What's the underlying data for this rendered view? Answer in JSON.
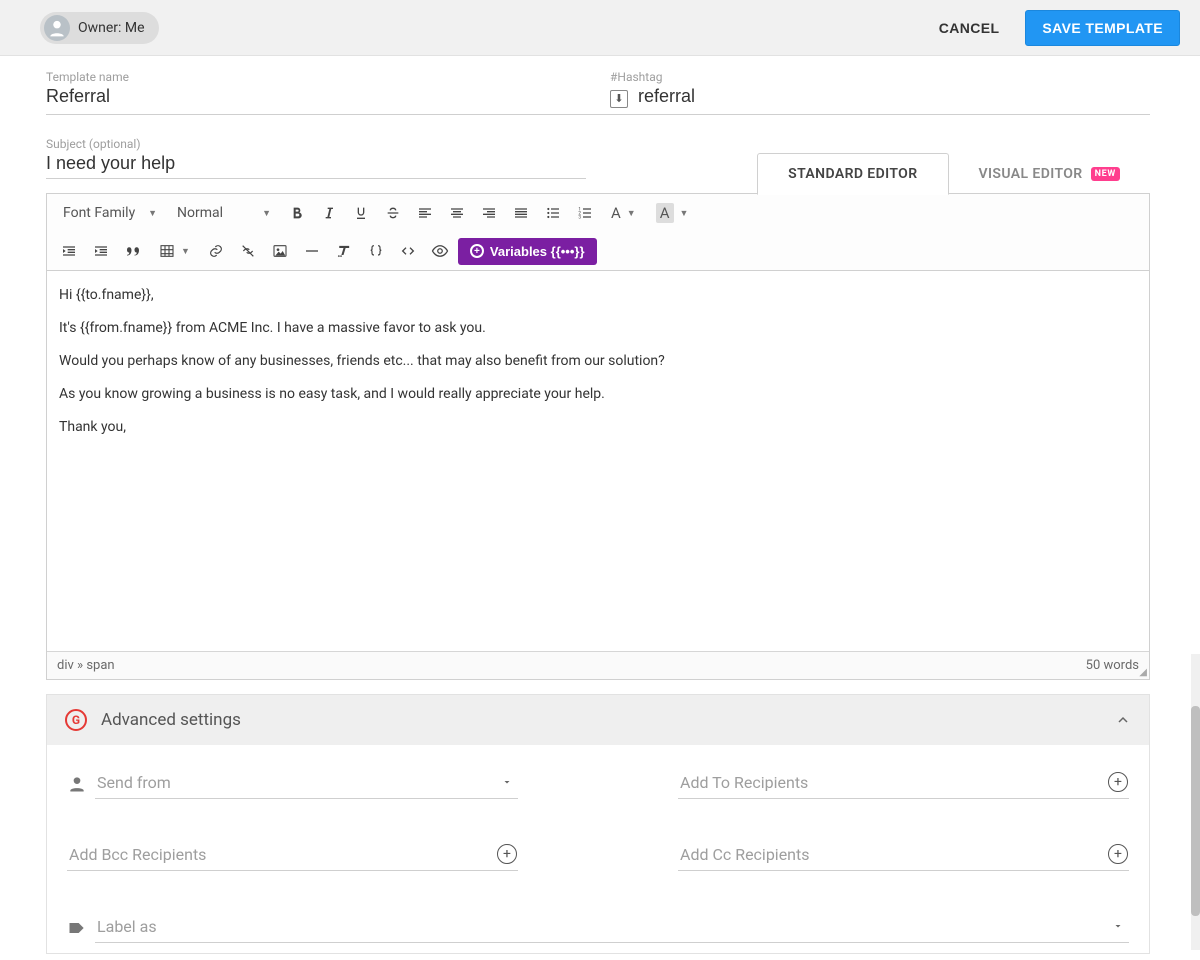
{
  "header": {
    "owner_label": "Owner: Me",
    "cancel": "CANCEL",
    "save": "SAVE TEMPLATE"
  },
  "fields": {
    "template_name_label": "Template name",
    "template_name_value": "Referral",
    "hashtag_label": "#Hashtag",
    "hashtag_value": "referral",
    "subject_label": "Subject (optional)",
    "subject_value": "I need your help"
  },
  "tabs": {
    "standard": "STANDARD EDITOR",
    "visual": "VISUAL EDITOR",
    "new_badge": "NEW"
  },
  "toolbar": {
    "font_family": "Font Family",
    "format": "Normal",
    "variables": "Variables {{•••}}"
  },
  "editor": {
    "p1": "Hi {{to.fname}},",
    "p2": "It's {{from.fname}} from ACME Inc. I have a massive favor to ask you.",
    "p3": "Would you perhaps know of any businesses, friends etc... that may also benefit from our solution?",
    "p4": "As you know growing a business is no easy task, and I would really appreciate your help.",
    "p5": "Thank you,"
  },
  "status": {
    "path": "div » span",
    "words": "50 words"
  },
  "advanced": {
    "title": "Advanced settings",
    "send_from": "Send from",
    "add_to": "Add To Recipients",
    "add_bcc": "Add Bcc Recipients",
    "add_cc": "Add Cc Recipients",
    "label_as": "Label as"
  }
}
